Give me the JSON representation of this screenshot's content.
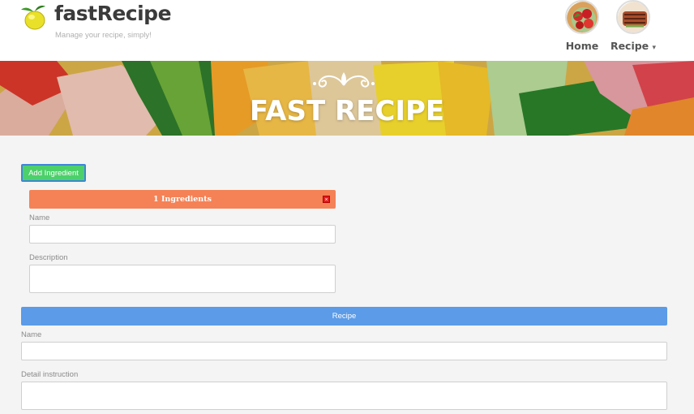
{
  "header": {
    "brand": "fastRecipe",
    "tagline": "Manage your recipe, simply!",
    "logo_icon": "lemon-icon",
    "nav": [
      {
        "label": "Home",
        "thumb_icon": "strawberry-bowl-icon"
      },
      {
        "label": "Recipe",
        "thumb_icon": "grilled-meat-icon",
        "caret": "▾"
      }
    ]
  },
  "banner": {
    "title": "FAST RECIPE",
    "ornament_icon": "flourish-ornament-icon"
  },
  "form": {
    "add_ingredient_label": "Add Ingredient",
    "ingredient_panel": {
      "title": "1 Ingredients",
      "close_glyph": "×",
      "name_label": "Name",
      "name_value": "",
      "description_label": "Description",
      "description_value": ""
    },
    "recipe_panel": {
      "title": "Recipe",
      "name_label": "Name",
      "name_value": "",
      "detail_label": "Detail instruction",
      "detail_value": ""
    }
  },
  "colors": {
    "add_button": "#4cd06a",
    "ingredient_header": "#f48256",
    "close_button": "#e01e1e",
    "recipe_header": "#5b9be8"
  }
}
